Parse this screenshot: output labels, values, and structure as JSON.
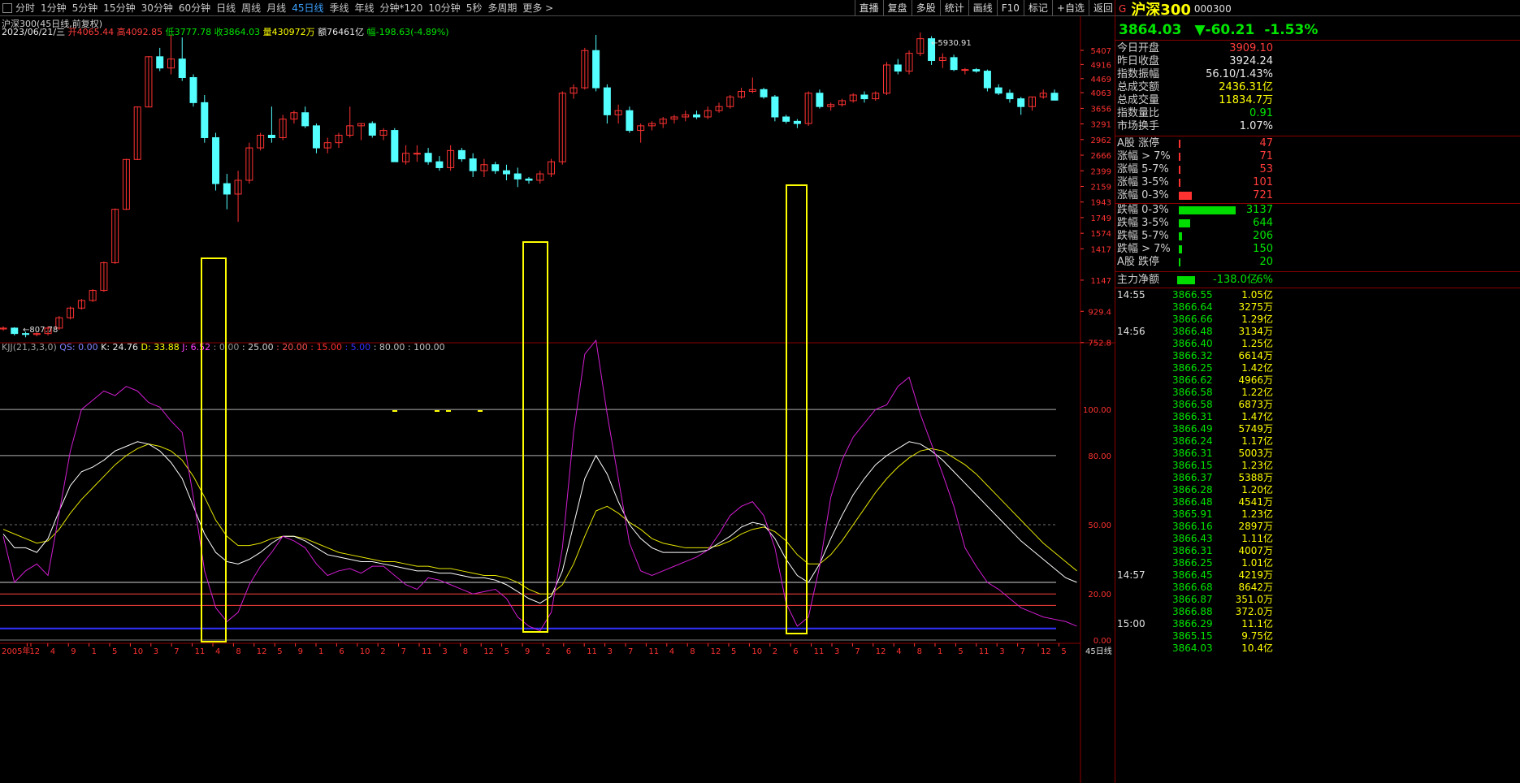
{
  "toolbar": {
    "periods": [
      "分时",
      "1分钟",
      "5分钟",
      "15分钟",
      "30分钟",
      "60分钟",
      "日线",
      "周线",
      "月线",
      "45日线",
      "季线",
      "年线",
      "分钟*120",
      "10分钟",
      "5秒",
      "多周期",
      "更多 >"
    ],
    "active_period": "45日线",
    "right_tools": [
      "直播",
      "复盘",
      "多股",
      "统计",
      "画线",
      "F10",
      "标记",
      "+自选",
      "返回"
    ]
  },
  "chart": {
    "title": "沪深300(45日线,前复权)",
    "ohlc": {
      "date": "2023/06/21/三",
      "open_label": "开",
      "open": "4065.44",
      "high_label": "高",
      "high": "4092.85",
      "low_label": "低",
      "low": "3777.78",
      "close_label": "收",
      "close": "3864.03",
      "vol_label": "量",
      "vol": "430972万",
      "amt_label": "额",
      "amt": "76461亿",
      "chg_label": "幅",
      "chg": "-198.63(-4.89%)"
    },
    "high_marker": "5930.91",
    "low_marker": "807.78",
    "price_axis": [
      "5407",
      "4916",
      "4469",
      "4063",
      "3656",
      "3291",
      "2962",
      "2666",
      "2399",
      "2159",
      "1943",
      "1749",
      "1574",
      "1417",
      "1147",
      "929.4",
      "752.8"
    ],
    "kdj_legend": {
      "name": "KJJ(21,3,3,0)",
      "qs": "QS: 0.00",
      "k": "K: 24.76",
      "d": "D: 33.88",
      "j": "J: 6.52",
      "l1": ": 0.00",
      "l2": ": 25.00",
      "l3": ": 20.00",
      "l4": ": 15.00",
      "l5": ": 5.00",
      "l6": ": 80.00",
      "l7": ": 100.00"
    },
    "kdj_axis": [
      "100.00",
      "80.00",
      "50.00",
      "20.00",
      "0.00"
    ],
    "x_labels": [
      "2005年",
      "12",
      "4",
      "9",
      "1",
      "5",
      "10",
      "3",
      "7",
      "11",
      "4",
      "8",
      "12",
      "5",
      "9",
      "1",
      "6",
      "10",
      "2",
      "7",
      "11",
      "3",
      "8",
      "12",
      "5",
      "9",
      "2",
      "6",
      "11",
      "3",
      "7",
      "11",
      "4",
      "8",
      "12",
      "5",
      "10",
      "2",
      "6",
      "11",
      "3",
      "7",
      "12",
      "4",
      "8",
      "1",
      "5",
      "11",
      "3",
      "7",
      "12",
      "5"
    ],
    "period_label": "45日线",
    "colors": {
      "up": "#ff3232",
      "down": "#54ffff",
      "k": "#ffffff",
      "d": "#e6e600",
      "j": "#d21ed2",
      "highlight": "#ffff00"
    }
  },
  "chart_data": {
    "type": "candlestick",
    "series_candles": [
      [
        825,
        840,
        815,
        830
      ],
      [
        830,
        835,
        790,
        800
      ],
      [
        800,
        810,
        780,
        795
      ],
      [
        795,
        805,
        785,
        800
      ],
      [
        800,
        840,
        790,
        830
      ],
      [
        830,
        900,
        820,
        890
      ],
      [
        890,
        960,
        880,
        950
      ],
      [
        950,
        1010,
        940,
        1000
      ],
      [
        1000,
        1080,
        990,
        1070
      ],
      [
        1070,
        1300,
        1060,
        1290
      ],
      [
        1290,
        1860,
        1280,
        1850
      ],
      [
        1850,
        2600,
        1840,
        2590
      ],
      [
        2590,
        3700,
        2580,
        3690
      ],
      [
        3690,
        5200,
        3680,
        5180
      ],
      [
        5180,
        5500,
        4700,
        4800
      ],
      [
        4800,
        6000,
        4600,
        5100
      ],
      [
        5100,
        5900,
        4400,
        4500
      ],
      [
        4500,
        4600,
        3700,
        3800
      ],
      [
        3800,
        4000,
        2900,
        3000
      ],
      [
        3000,
        3100,
        2100,
        2200
      ],
      [
        2200,
        2350,
        1850,
        2050
      ],
      [
        2050,
        2400,
        1700,
        2250
      ],
      [
        2250,
        2900,
        2200,
        2800
      ],
      [
        2800,
        3100,
        2750,
        3050
      ],
      [
        3050,
        3700,
        2900,
        3000
      ],
      [
        3000,
        3500,
        2950,
        3400
      ],
      [
        3400,
        3600,
        3300,
        3550
      ],
      [
        3550,
        3700,
        3200,
        3250
      ],
      [
        3250,
        3300,
        2700,
        2800
      ],
      [
        2800,
        3000,
        2700,
        2900
      ],
      [
        2900,
        3100,
        2800,
        3050
      ],
      [
        3050,
        3700,
        3000,
        3250
      ],
      [
        3250,
        3300,
        2950,
        3300
      ],
      [
        3300,
        3350,
        3000,
        3050
      ],
      [
        3050,
        3200,
        2950,
        3150
      ],
      [
        3150,
        3200,
        2600,
        2550
      ],
      [
        2550,
        2850,
        2500,
        2700
      ],
      [
        2700,
        2850,
        2550,
        2700
      ],
      [
        2700,
        2800,
        2500,
        2550
      ],
      [
        2550,
        2650,
        2400,
        2450
      ],
      [
        2450,
        2850,
        2400,
        2750
      ],
      [
        2750,
        2800,
        2550,
        2600
      ],
      [
        2600,
        2700,
        2300,
        2400
      ],
      [
        2400,
        2600,
        2300,
        2500
      ],
      [
        2500,
        2550,
        2350,
        2400
      ],
      [
        2400,
        2500,
        2250,
        2350
      ],
      [
        2350,
        2450,
        2150,
        2270
      ],
      [
        2270,
        2300,
        2200,
        2250
      ],
      [
        2250,
        2400,
        2200,
        2350
      ],
      [
        2350,
        2600,
        2300,
        2550
      ],
      [
        2550,
        4100,
        2500,
        4050
      ],
      [
        4050,
        4300,
        3900,
        4200
      ],
      [
        4200,
        5500,
        4150,
        5400
      ],
      [
        5400,
        6000,
        4100,
        4200
      ],
      [
        4200,
        4300,
        3300,
        3500
      ],
      [
        3500,
        3750,
        3300,
        3600
      ],
      [
        3600,
        3700,
        3100,
        3150
      ],
      [
        3150,
        3300,
        2900,
        3250
      ],
      [
        3250,
        3350,
        3150,
        3300
      ],
      [
        3300,
        3450,
        3200,
        3400
      ],
      [
        3400,
        3500,
        3300,
        3450
      ],
      [
        3450,
        3600,
        3350,
        3500
      ],
      [
        3500,
        3600,
        3400,
        3450
      ],
      [
        3450,
        3700,
        3400,
        3600
      ],
      [
        3600,
        3800,
        3550,
        3700
      ],
      [
        3700,
        4000,
        3650,
        3950
      ],
      [
        3950,
        4200,
        3900,
        4100
      ],
      [
        4100,
        4500,
        4050,
        4150
      ],
      [
        4150,
        4200,
        3900,
        3950
      ],
      [
        3950,
        4000,
        3350,
        3450
      ],
      [
        3450,
        3500,
        3300,
        3350
      ],
      [
        3350,
        3400,
        3200,
        3300
      ],
      [
        3300,
        4100,
        3250,
        4050
      ],
      [
        4050,
        4150,
        3650,
        3700
      ],
      [
        3700,
        3800,
        3600,
        3750
      ],
      [
        3750,
        3900,
        3700,
        3850
      ],
      [
        3850,
        4050,
        3800,
        4000
      ],
      [
        4000,
        4100,
        3800,
        3900
      ],
      [
        3900,
        4100,
        3850,
        4050
      ],
      [
        4050,
        5000,
        4000,
        4900
      ],
      [
        4900,
        5100,
        4600,
        4700
      ],
      [
        4700,
        5400,
        4600,
        5300
      ],
      [
        5300,
        6100,
        5200,
        5850
      ],
      [
        5850,
        5950,
        4900,
        5050
      ],
      [
        5050,
        5300,
        4800,
        5150
      ],
      [
        5150,
        5250,
        4700,
        4750
      ],
      [
        4750,
        4800,
        4600,
        4750
      ],
      [
        4750,
        4800,
        4650,
        4700
      ],
      [
        4700,
        4750,
        4100,
        4200
      ],
      [
        4200,
        4300,
        4000,
        4050
      ],
      [
        4050,
        4150,
        3800,
        3900
      ],
      [
        3900,
        3950,
        3500,
        3700
      ],
      [
        3700,
        3950,
        3600,
        3950
      ],
      [
        3950,
        4150,
        3900,
        4050
      ],
      [
        4050,
        4150,
        3900,
        3864
      ]
    ],
    "k": [
      46,
      40,
      40,
      38,
      44,
      56,
      67,
      73,
      75,
      78,
      82,
      84,
      86,
      85,
      82,
      77,
      70,
      58,
      46,
      38,
      34,
      33,
      35,
      38,
      42,
      45,
      45,
      43,
      40,
      37,
      36,
      35,
      34,
      34,
      33,
      32,
      31,
      30,
      30,
      29,
      29,
      28,
      27,
      27,
      26,
      24,
      21,
      18,
      16,
      19,
      30,
      50,
      70,
      80,
      72,
      60,
      50,
      44,
      40,
      38,
      38,
      38,
      38,
      39,
      42,
      45,
      49,
      51,
      50,
      44,
      35,
      28,
      25,
      33,
      44,
      54,
      63,
      70,
      76,
      80,
      83,
      86,
      85,
      82,
      78,
      73,
      68,
      63,
      58,
      53,
      48,
      43,
      39,
      35,
      31,
      27,
      25
    ],
    "d": [
      48,
      46,
      44,
      42,
      43,
      48,
      55,
      61,
      66,
      71,
      76,
      80,
      83,
      85,
      84,
      82,
      78,
      71,
      62,
      52,
      45,
      41,
      41,
      42,
      44,
      45,
      45,
      44,
      42,
      40,
      38,
      37,
      36,
      35,
      34,
      34,
      33,
      32,
      32,
      31,
      31,
      30,
      29,
      28,
      28,
      27,
      25,
      22,
      20,
      20,
      24,
      33,
      45,
      56,
      58,
      55,
      51,
      48,
      44,
      42,
      41,
      40,
      40,
      40,
      41,
      43,
      46,
      48,
      49,
      47,
      43,
      37,
      33,
      33,
      37,
      43,
      50,
      57,
      64,
      70,
      75,
      79,
      82,
      83,
      82,
      79,
      76,
      72,
      67,
      62,
      57,
      52,
      47,
      42,
      38,
      34,
      30
    ],
    "j": [
      45,
      25,
      30,
      33,
      28,
      55,
      82,
      100,
      104,
      108,
      106,
      110,
      108,
      103,
      101,
      95,
      90,
      62,
      30,
      14,
      8,
      12,
      24,
      32,
      38,
      45,
      43,
      40,
      33,
      28,
      30,
      31,
      29,
      32,
      32,
      28,
      24,
      22,
      27,
      26,
      24,
      22,
      20,
      21,
      22,
      18,
      10,
      6,
      4,
      12,
      40,
      90,
      124,
      130,
      98,
      70,
      42,
      30,
      28,
      30,
      32,
      34,
      36,
      39,
      46,
      54,
      58,
      60,
      54,
      40,
      16,
      6,
      10,
      32,
      62,
      78,
      88,
      94,
      100,
      102,
      110,
      114,
      98,
      85,
      72,
      58,
      40,
      32,
      25,
      22,
      18,
      14,
      12,
      10,
      9,
      8,
      6
    ]
  },
  "side": {
    "g_mark": "G",
    "name": "沪深300",
    "code": "000300",
    "price": "3864.03",
    "change": "▼-60.21",
    "pct": "-1.53%",
    "stats": [
      {
        "label": "今日开盘",
        "value": "3909.10",
        "color": "red"
      },
      {
        "label": "昨日收盘",
        "value": "3924.24",
        "color": "white"
      },
      {
        "label": "指数振幅",
        "value": "56.10/1.43%",
        "color": "white"
      },
      {
        "label": "总成交额",
        "value": "2436.31亿",
        "color": "yellow"
      },
      {
        "label": "总成交量",
        "value": "11834.7万",
        "color": "yellow"
      },
      {
        "label": "指数量比",
        "value": "0.91",
        "color": "green"
      },
      {
        "label": "市场换手",
        "value": "1.07%",
        "color": "white"
      }
    ],
    "breadth": [
      {
        "label": "A股 涨停",
        "value": "47",
        "bar": 0.01,
        "color": "red"
      },
      {
        "label": "涨幅 > 7%",
        "value": "71",
        "bar": 0.01,
        "color": "red"
      },
      {
        "label": "涨幅 5-7%",
        "value": "53",
        "bar": 0.01,
        "color": "red"
      },
      {
        "label": "涨幅 3-5%",
        "value": "101",
        "bar": 0.02,
        "color": "red"
      },
      {
        "label": "涨幅 0-3%",
        "value": "721",
        "bar": 0.23,
        "color": "red"
      },
      {
        "label": "跌幅 0-3%",
        "value": "3137",
        "bar": 1.0,
        "color": "green"
      },
      {
        "label": "跌幅 3-5%",
        "value": "644",
        "bar": 0.2,
        "color": "green"
      },
      {
        "label": "跌幅 5-7%",
        "value": "206",
        "bar": 0.06,
        "color": "green"
      },
      {
        "label": "跌幅 > 7%",
        "value": "150",
        "bar": 0.05,
        "color": "green"
      },
      {
        "label": "A股 跌停",
        "value": "20",
        "bar": 0.01,
        "color": "green"
      }
    ],
    "main_flow": {
      "label": "主力净额",
      "value": "-138.0亿",
      "pct": "-6%"
    },
    "ticks": [
      {
        "time": "14:55",
        "price": "3866.55",
        "vol": "1.05亿"
      },
      {
        "time": "",
        "price": "3866.64",
        "vol": "3275万"
      },
      {
        "time": "",
        "price": "3866.66",
        "vol": "1.29亿"
      },
      {
        "time": "14:56",
        "price": "3866.48",
        "vol": "3134万"
      },
      {
        "time": "",
        "price": "3866.40",
        "vol": "1.25亿"
      },
      {
        "time": "",
        "price": "3866.32",
        "vol": "6614万"
      },
      {
        "time": "",
        "price": "3866.25",
        "vol": "1.42亿"
      },
      {
        "time": "",
        "price": "3866.62",
        "vol": "4966万"
      },
      {
        "time": "",
        "price": "3866.58",
        "vol": "1.22亿"
      },
      {
        "time": "",
        "price": "3866.58",
        "vol": "6873万"
      },
      {
        "time": "",
        "price": "3866.31",
        "vol": "1.47亿"
      },
      {
        "time": "",
        "price": "3866.49",
        "vol": "5749万"
      },
      {
        "time": "",
        "price": "3866.24",
        "vol": "1.17亿"
      },
      {
        "time": "",
        "price": "3866.31",
        "vol": "5003万"
      },
      {
        "time": "",
        "price": "3866.15",
        "vol": "1.23亿"
      },
      {
        "time": "",
        "price": "3866.37",
        "vol": "5388万"
      },
      {
        "time": "",
        "price": "3866.28",
        "vol": "1.20亿"
      },
      {
        "time": "",
        "price": "3866.48",
        "vol": "4541万"
      },
      {
        "time": "",
        "price": "3865.91",
        "vol": "1.23亿"
      },
      {
        "time": "",
        "price": "3866.16",
        "vol": "2897万"
      },
      {
        "time": "",
        "price": "3866.43",
        "vol": "1.11亿"
      },
      {
        "time": "",
        "price": "3866.31",
        "vol": "4007万"
      },
      {
        "time": "",
        "price": "3866.25",
        "vol": "1.01亿"
      },
      {
        "time": "14:57",
        "price": "3866.45",
        "vol": "4219万"
      },
      {
        "time": "",
        "price": "3866.68",
        "vol": "8642万"
      },
      {
        "time": "",
        "price": "3866.87",
        "vol": "351.0万"
      },
      {
        "time": "",
        "price": "3866.88",
        "vol": "372.0万"
      },
      {
        "time": "15:00",
        "price": "3866.29",
        "vol": "11.1亿"
      },
      {
        "time": "",
        "price": "3865.15",
        "vol": "9.75亿"
      },
      {
        "time": "",
        "price": "3864.03",
        "vol": "10.4亿"
      }
    ]
  }
}
